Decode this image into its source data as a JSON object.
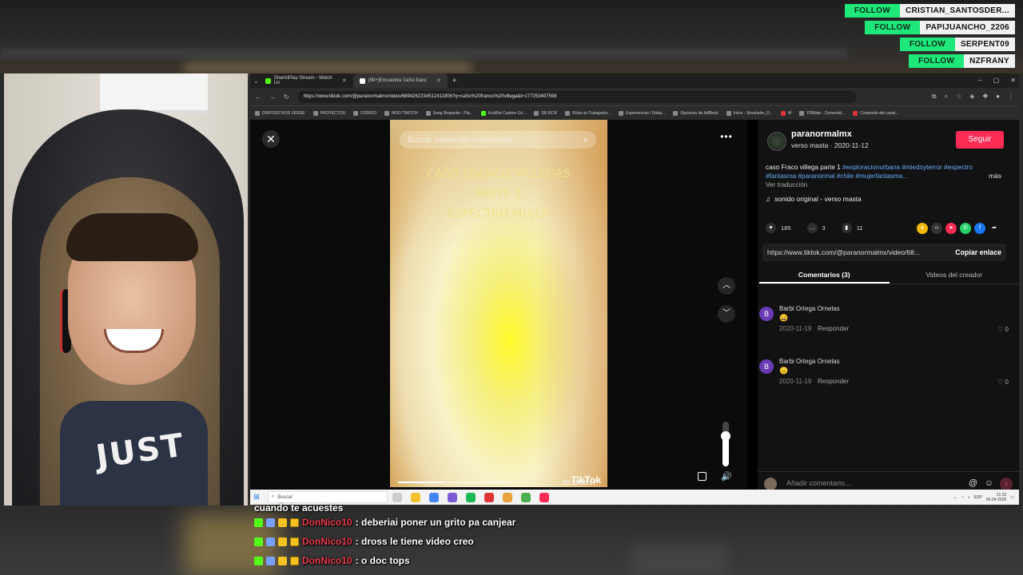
{
  "follow_alerts": [
    {
      "label": "FOLLOW",
      "name": "CRISTIAN_SANTOSDER..."
    },
    {
      "label": "FOLLOW",
      "name": "PAPIJUANCHO_2206"
    },
    {
      "label": "FOLLOW",
      "name": "SERPENT09"
    },
    {
      "label": "FOLLOW",
      "name": "NZFRANY"
    }
  ],
  "webcam": {
    "shirt_text": "JUST"
  },
  "browser": {
    "tabs": [
      {
        "label": "ShamiiPlay Stream - Watch Liv",
        "color": "#53fc18"
      },
      {
        "label": "(99+)Encuentra 'caSo franc",
        "color": "#ffffff"
      }
    ],
    "window_controls": [
      "–",
      "▢",
      "✕"
    ],
    "url": "https://www.tiktok.com/@paranormalmx/video/6894262234512411906?q=caSo%20franco%20villega&t=1772534975​98",
    "bookmarks": [
      "DISPOSITIVOS VERSE",
      "PROYECTOS",
      "CODIGO",
      "MOD TWITCH",
      "Song Requests - Pla...",
      "KickBot Custom Co...",
      "SR KICK",
      "Roba un Trabajador...",
      "Experiencias / Roba...",
      "Opciones de AdBlock",
      "Inicio - Simulador_D...",
      "M",
      "YDMate - Convertid...",
      "Contenido del canal..."
    ]
  },
  "tiktok": {
    "search_placeholder": "Buscar contenido relacionado",
    "overlay_lines": [
      "CASO FRANCO VILLEGAS",
      "PARTE 1",
      "ESPECTRO MUJER"
    ],
    "watermark": "TikTok",
    "time": "00:12/00:17",
    "author": {
      "username": "paranormalmx",
      "meta": "verso masta · 2020-11-12",
      "follow_label": "Seguir"
    },
    "description": {
      "text": "caso Fraco villega parte 1",
      "tags": "#exploracionurbana #miedoyterror #espectro #fantasma #paranormal #chile #mujerfantasma...",
      "translate": "Ver traducción",
      "more": "más"
    },
    "sound": "sonido original - verso masta",
    "stats": {
      "likes": "185",
      "comments": "3",
      "saves": "11"
    },
    "link": {
      "url": "https://www.tiktok.com/@paranormalmx/video/68...",
      "copy_label": "Copiar enlace"
    },
    "tabs": {
      "comments": "Comentarios (3)",
      "videos": "Videos del creador"
    },
    "comments": [
      {
        "initial": "B",
        "name": "Barbi Ortega Ornelas",
        "emoji": "😀",
        "date": "2020-11-19",
        "reply": "Responder",
        "likes": "0"
      },
      {
        "initial": "B",
        "name": "Barbi Ortega Ornelas",
        "emoji": "😑",
        "date": "2020-11-19",
        "reply": "Responder",
        "likes": "0"
      }
    ],
    "add_comment_placeholder": "Añadir comentario..."
  },
  "taskbar": {
    "search_placeholder": "Buscar",
    "time": "21:32",
    "date": "26-04-2026",
    "lang": "ESP"
  },
  "chat": [
    {
      "user": "",
      "message": "cuando te acuestes"
    },
    {
      "user": "DonNico10",
      "message": ": deberiai poner un grito pa canjear"
    },
    {
      "user": "DonNico10",
      "message": ": dross le tiene video creo"
    },
    {
      "user": "DonNico10",
      "message": ": o doc tops"
    }
  ],
  "colors": {
    "follow_green": "#1ee87a",
    "tiktok_red": "#fe2c55",
    "hashtag_blue": "#6aa9ff",
    "chat_user": "#e8394b"
  }
}
